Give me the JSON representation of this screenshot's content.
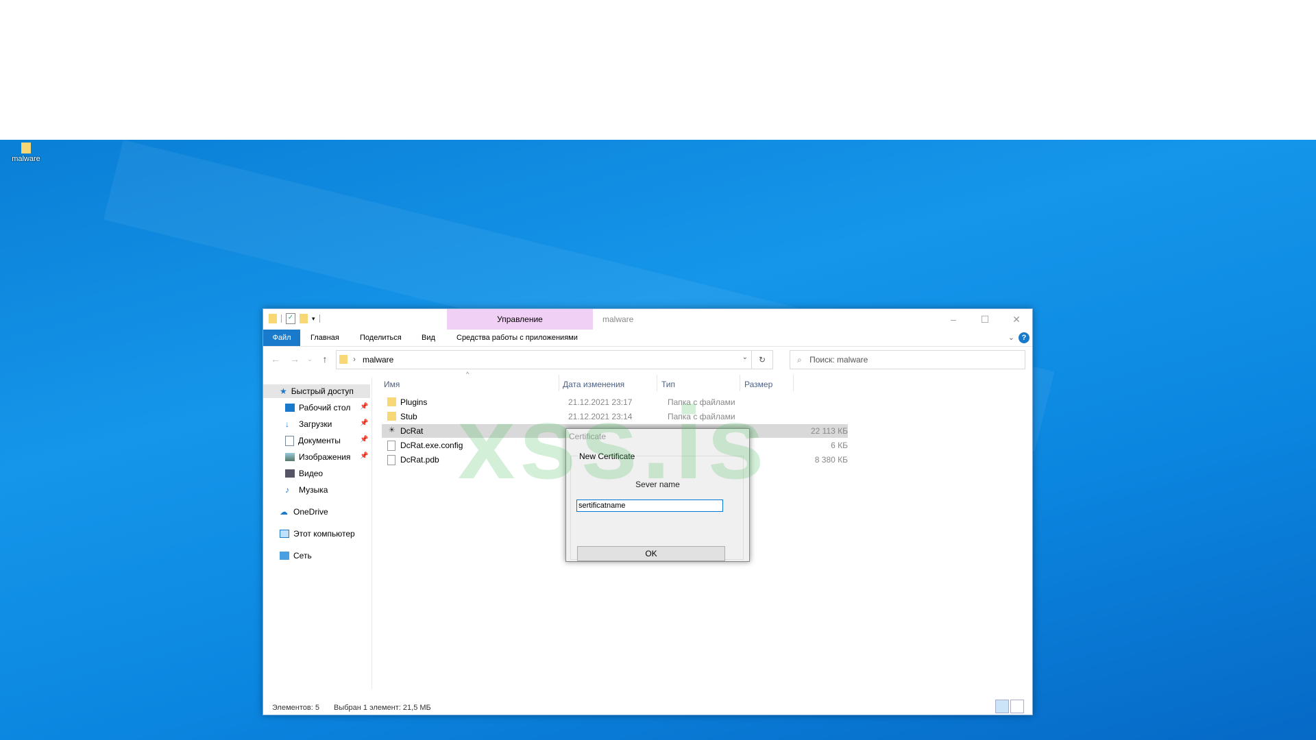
{
  "desktop": {
    "icon_label": "malware"
  },
  "explorer": {
    "window_title": "malware",
    "context_group": "Управление",
    "tabs": {
      "file": "Файл",
      "home": "Главная",
      "share": "Поделиться",
      "view": "Вид",
      "app_tools": "Средства работы с приложениями"
    },
    "address": {
      "path": "malware"
    },
    "search": {
      "placeholder": "Поиск: malware"
    },
    "sidebar": {
      "quick_access": "Быстрый доступ",
      "items": [
        "Рабочий стол",
        "Загрузки",
        "Документы",
        "Изображения",
        "Видео",
        "Музыка"
      ],
      "onedrive": "OneDrive",
      "this_pc": "Этот компьютер",
      "network": "Сеть"
    },
    "columns": {
      "name": "Имя",
      "date": "Дата изменения",
      "type": "Тип",
      "size": "Размер"
    },
    "files": [
      {
        "name": "Plugins",
        "date": "21.12.2021 23:17",
        "type": "Папка с файлами",
        "size": ""
      },
      {
        "name": "Stub",
        "date": "21.12.2021 23:14",
        "type": "Папка с файлами",
        "size": ""
      },
      {
        "name": "DcRat",
        "date": "",
        "type": "",
        "size": "22 113 КБ"
      },
      {
        "name": "DcRat.exe.config",
        "date": "",
        "type": "",
        "size": "6 КБ"
      },
      {
        "name": "DcRat.pdb",
        "date": "",
        "type": "",
        "size": "8 380 КБ"
      }
    ],
    "status": {
      "count": "Элементов: 5",
      "selection": "Выбран 1 элемент: 21,5 МБ"
    }
  },
  "dialog": {
    "title": "Certificate",
    "group": "New Certificate",
    "server_label": "Sever name",
    "input_value": "sertificatname",
    "ok": "OK"
  },
  "watermark": "xss.is",
  "colors": {
    "accent": "#1979ca",
    "context_tab": "#f0d0f4",
    "selected_row": "#d9d9d9"
  }
}
